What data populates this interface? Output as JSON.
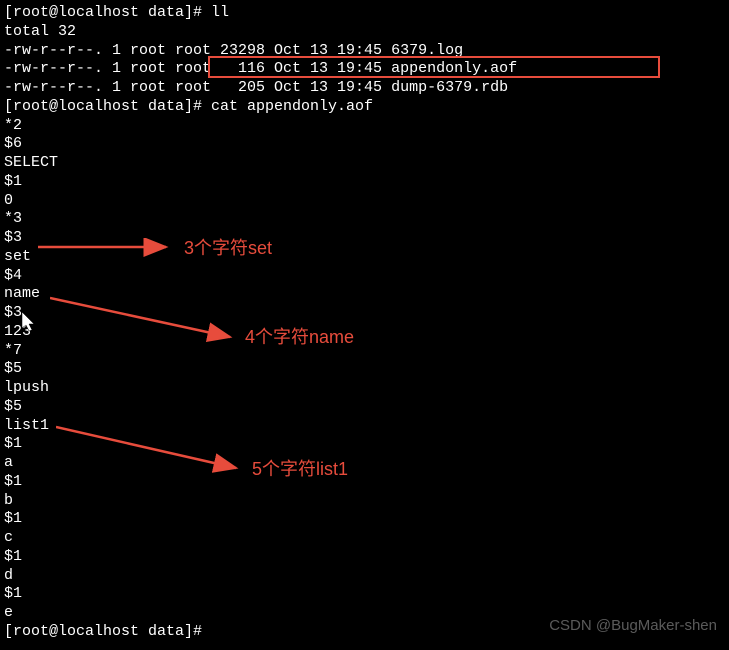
{
  "terminal": {
    "lines": [
      "[root@localhost data]# ll",
      "total 32",
      "-rw-r--r--. 1 root root 23298 Oct 13 19:45 6379.log",
      "-rw-r--r--. 1 root root   116 Oct 13 19:45 appendonly.aof",
      "-rw-r--r--. 1 root root   205 Oct 13 19:45 dump-6379.rdb",
      "[root@localhost data]# cat appendonly.aof",
      "*2",
      "$6",
      "SELECT",
      "$1",
      "0",
      "*3",
      "$3",
      "set",
      "$4",
      "name",
      "$3",
      "123",
      "*7",
      "$5",
      "lpush",
      "$5",
      "list1",
      "$1",
      "a",
      "$1",
      "b",
      "$1",
      "c",
      "$1",
      "d",
      "$1",
      "e",
      "[root@localhost data]#"
    ]
  },
  "annotations": {
    "note1": "3个字符set",
    "note2": "4个字符name",
    "note3": "5个字符list1"
  },
  "watermark": "CSDN @BugMaker-shen",
  "colors": {
    "highlight": "#e74c3c"
  }
}
